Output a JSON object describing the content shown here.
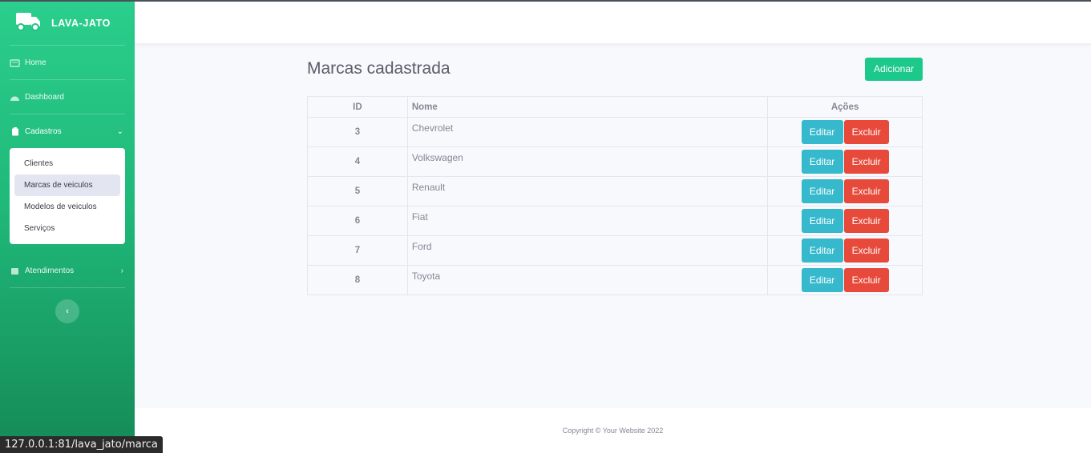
{
  "sidebar": {
    "brand": "LAVA-JATO",
    "home": "Home",
    "dashboard": "Dashboard",
    "cadastros": "Cadastros",
    "submenu": [
      "Clientes",
      "Marcas de veiculos",
      "Modelos de veiculos",
      "Serviços"
    ],
    "atendimentos": "Atendimentos"
  },
  "main": {
    "title": "Marcas cadastrada",
    "add_button": "Adicionar",
    "table": {
      "headers": [
        "ID",
        "Nome",
        "Ações"
      ],
      "rows": [
        {
          "id": "3",
          "nome": "Chevrolet"
        },
        {
          "id": "4",
          "nome": "Volkswagen"
        },
        {
          "id": "5",
          "nome": "Renault"
        },
        {
          "id": "6",
          "nome": "Fiat"
        },
        {
          "id": "7",
          "nome": "Ford"
        },
        {
          "id": "8",
          "nome": "Toyota"
        }
      ],
      "edit_label": "Editar",
      "delete_label": "Excluir"
    }
  },
  "footer": {
    "copyright": "Copyright © Your Website 2022"
  },
  "statusbar": {
    "url": "127.0.0.1:81/lava_jato/marca"
  },
  "colors": {
    "primary": "#1cc88a",
    "info": "#36b9cc",
    "danger": "#e74a3b"
  }
}
